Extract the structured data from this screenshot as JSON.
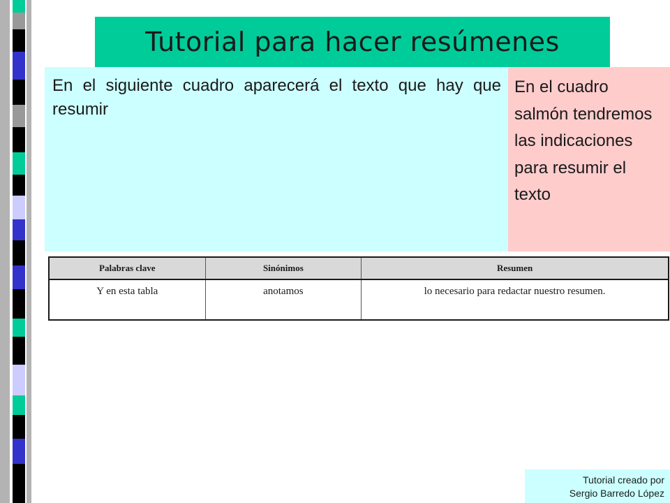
{
  "slide": {
    "title": "Tutorial para hacer resúmenes",
    "text_box": {
      "label": "En el siguiente cuadro aparecerá el texto que hay que resumir"
    },
    "salmon_box": {
      "label": "En el cuadro salmón tendremos las indicaciones para resumir el texto"
    },
    "table": {
      "headers": [
        "Palabras clave",
        "Sinónimos",
        "Resumen"
      ],
      "rows": [
        [
          "Y en esta tabla",
          "anotamos",
          "lo necesario para redactar nuestro resumen."
        ]
      ]
    },
    "credit": {
      "line1": "Tutorial creado por",
      "line2": "Sergio Barredo López"
    }
  },
  "colors": {
    "title_bg": "#00cc99",
    "text_box_bg": "#ccffff",
    "salmon_bg": "#ffcccc",
    "stripe_colors": [
      "#000000",
      "#3333cc",
      "#999999",
      "#00cc99",
      "#ccccff"
    ]
  }
}
